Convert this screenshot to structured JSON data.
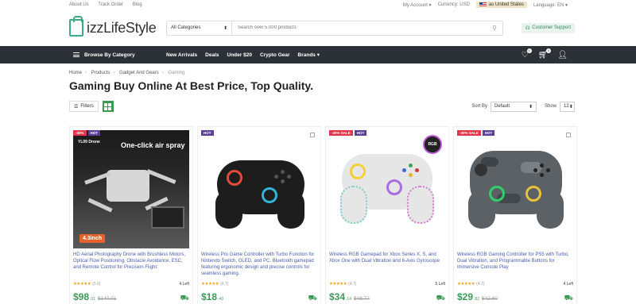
{
  "topbar": {
    "links": [
      "About Us",
      "Track Order",
      "Blog"
    ],
    "account": "My Account",
    "currency": "Currency: USD",
    "ship_to": "as United States",
    "language": "Language: EN"
  },
  "header": {
    "logo_text": "izzLifeStyle",
    "category_select": "All Categories",
    "search_placeholder": "Search over 5,000 products",
    "support_label": "Customer Support"
  },
  "nav": {
    "browse_label": "Browse By Category",
    "items": [
      "New Arrivals",
      "Deals",
      "Under $20",
      "Crypto Gear",
      "Brands"
    ],
    "wishlist_count": "0",
    "cart_count": "0"
  },
  "breadcrumb": [
    "Home",
    "Products",
    "Gadget And Gears",
    "Gaming"
  ],
  "page_title": "Gaming Buy Online At Best Price, Top Quality.",
  "toolbar": {
    "filters_label": "Filters",
    "sort_label": "Sort By",
    "sort_value": "Default",
    "show_label": "Show",
    "show_value": "12"
  },
  "products": [
    {
      "sale_tag": "-30%",
      "hot_tag": "HOT",
      "ad_brand": "YL09 Drone",
      "ad_text": "One-click air spray",
      "ad_cta": "4.3inch",
      "name": "HD Aerial Photography Drone with Brushless Motors, Optical Flow Positioning, Obstacle Avoidance, ESC, and Remote Control for Precision Flight.",
      "stars": "★★★★★",
      "rating": "(5.0)",
      "stock": "4 Left",
      "price": "$98",
      "cents": ".01",
      "old_price": "$140.01"
    },
    {
      "hot_tag": "HOT",
      "name": "Wireless Pro Game Controller with Turbo Function for Nintendo Switch, OLED, and PC. Bluetooth gamepad featuring ergonomic design and precise controls for seamless gaming.",
      "stars": "★★★★★",
      "rating": "(4.7)",
      "price": "$18",
      "cents": ".43"
    },
    {
      "sale_tag": "-30% SALE",
      "hot_tag": "HOT",
      "rgb_badge": "RGB",
      "name": "Wireless RGB Gamepad for Xbox Series X, S, and Xbox One with Dual Vibration and 6-Axis Gyroscope",
      "stars": "★★★★★",
      "rating": "(4.7)",
      "stock": "5 Left",
      "price": "$34",
      "cents": ".14",
      "old_price": "$48.77"
    },
    {
      "sale_tag": "-30% SALE",
      "hot_tag": "HOT",
      "name": "Wireless RGB Gaming Controller for PS5 with Turbo, Dual Vibration, and Programmable Buttons for Immersive Console Play",
      "stars": "★★★★★",
      "rating": "(4.7)",
      "stock": "4 Left",
      "price": "$29",
      "cents": ".82",
      "old_price": "$42.60"
    }
  ],
  "colors": {
    "accent_green": "#3a9a55",
    "nav_bg": "#2b3136",
    "sale_red": "#e0354a",
    "hot_purple": "#5c3f99",
    "link_blue": "#4a5ab0"
  }
}
